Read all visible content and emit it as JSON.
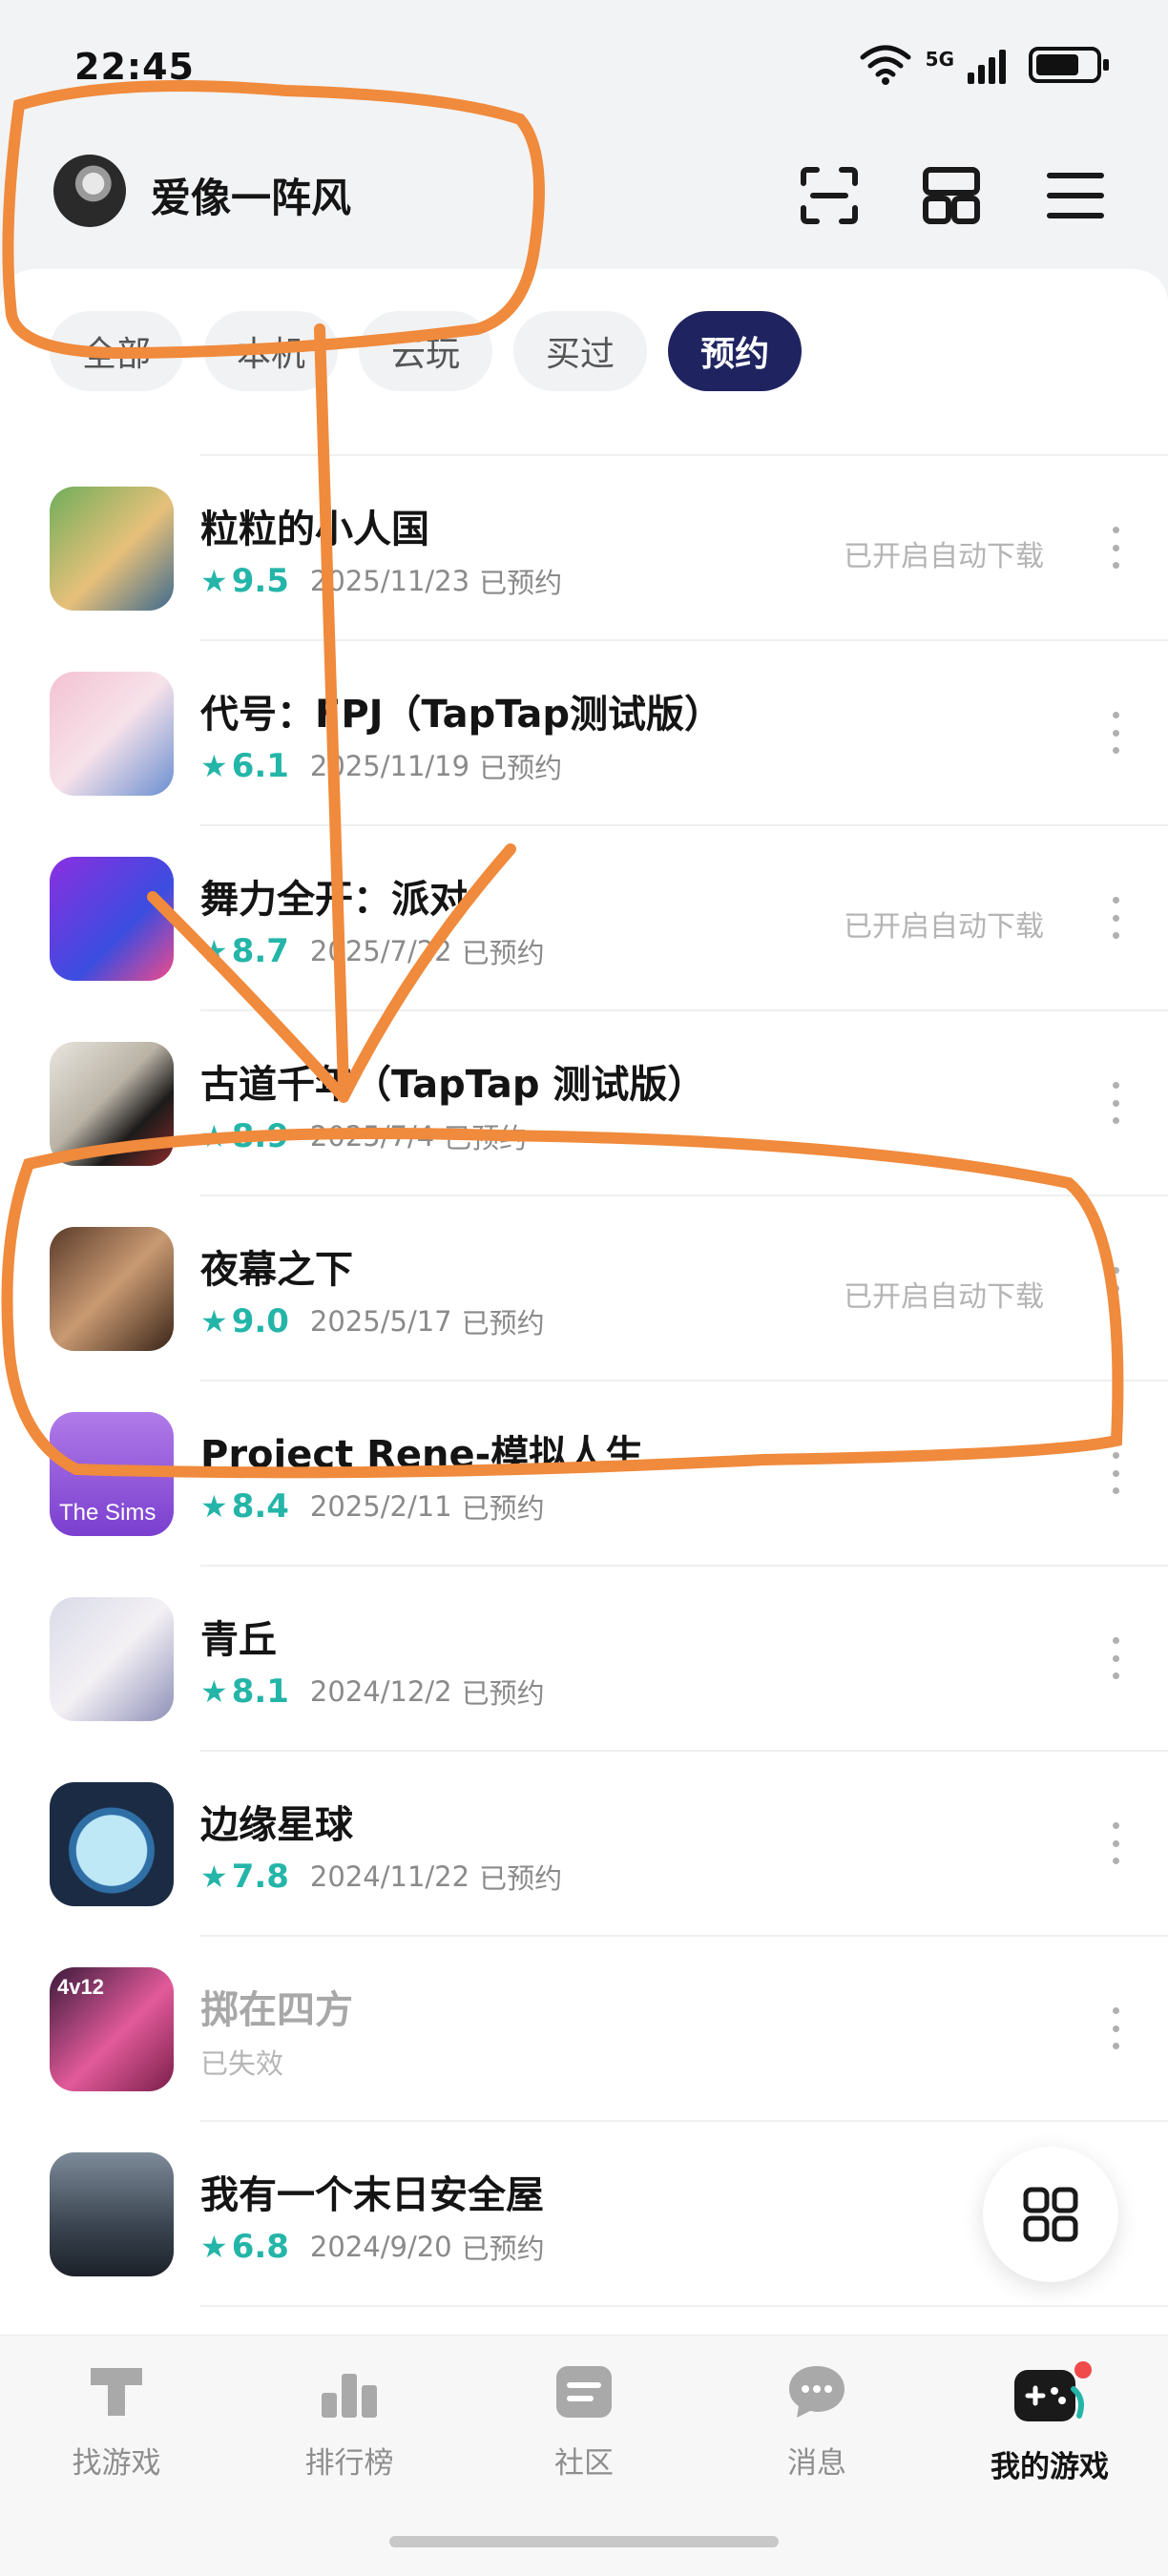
{
  "status_bar": {
    "time": "22:45",
    "network": "5G"
  },
  "header": {
    "username": "爱像一阵风"
  },
  "chips": [
    {
      "label": "全部",
      "active": false
    },
    {
      "label": "本机",
      "active": false
    },
    {
      "label": "云玩",
      "active": false
    },
    {
      "label": "买过",
      "active": false
    },
    {
      "label": "预约",
      "active": true
    }
  ],
  "games": [
    {
      "title": "粒粒的小人国",
      "rating": "9.5",
      "date": "2025/11/23",
      "status": "已预约",
      "auto_download": "已开启自动下载"
    },
    {
      "title": "代号：FPJ（TapTap测试版）",
      "rating": "6.1",
      "date": "2025/11/19",
      "status": "已预约",
      "auto_download": ""
    },
    {
      "title": "舞力全开：派对",
      "rating": "8.7",
      "date": "2025/7/22",
      "status": "已预约",
      "auto_download": "已开启自动下载"
    },
    {
      "title": "古道千年（TapTap 测试版）",
      "rating": "8.9",
      "date": "2025/7/4",
      "status": "已预约",
      "auto_download": ""
    },
    {
      "title": "夜幕之下",
      "rating": "9.0",
      "date": "2025/5/17",
      "status": "已预约",
      "auto_download": "已开启自动下载"
    },
    {
      "title": "Project Rene-模拟人生",
      "rating": "8.4",
      "date": "2025/2/11",
      "status": "已预约",
      "auto_download": "",
      "icon_text": "The Sims"
    },
    {
      "title": "青丘",
      "rating": "8.1",
      "date": "2024/12/2",
      "status": "已预约",
      "auto_download": ""
    },
    {
      "title": "边缘星球",
      "rating": "7.8",
      "date": "2024/11/22",
      "status": "已预约",
      "auto_download": ""
    },
    {
      "title": "掷在四方",
      "rating": "",
      "date": "",
      "status": "已失效",
      "auto_download": "",
      "icon_text": "4v12"
    },
    {
      "title": "我有一个末日安全屋",
      "rating": "6.8",
      "date": "2024/9/20",
      "status": "已预约",
      "auto_download": ""
    }
  ],
  "bottom_nav": [
    {
      "label": "找游戏",
      "icon": "taptap-icon"
    },
    {
      "label": "排行榜",
      "icon": "ranking-icon"
    },
    {
      "label": "社区",
      "icon": "community-icon"
    },
    {
      "label": "消息",
      "icon": "message-icon"
    },
    {
      "label": "我的游戏",
      "icon": "my-games-icon",
      "active": true
    }
  ],
  "colors": {
    "accent": "#24b5a8",
    "chip_active": "#1f2461",
    "annotation": "#f08a3c"
  }
}
